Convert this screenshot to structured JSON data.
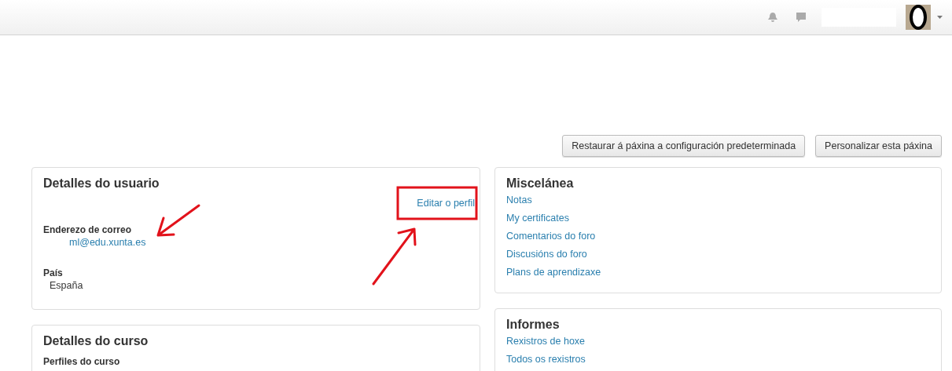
{
  "page_actions": [
    {
      "label": "Restaurar á páxina a configuración predeterminada"
    },
    {
      "label": "Personalizar esta páxina"
    }
  ],
  "user_details": {
    "title": "Detalles do usuario",
    "edit_link": "Editar o perfil",
    "fields": [
      {
        "label": "Enderezo de correo",
        "value": "ml@edu.xunta.es",
        "kind": "link"
      },
      {
        "label": "País",
        "value": "España",
        "kind": "text"
      }
    ]
  },
  "course_details": {
    "title": "Detalles do curso",
    "subtitle": "Perfiles do curso"
  },
  "miscellany": {
    "title": "Miscelánea",
    "links": [
      "Notas",
      "My certificates",
      "Comentarios do foro",
      "Discusións do foro",
      "Plans de aprendizaxe"
    ]
  },
  "reports": {
    "title": "Informes",
    "links": [
      "Rexistros de hoxe",
      "Todos os rexistros"
    ]
  }
}
